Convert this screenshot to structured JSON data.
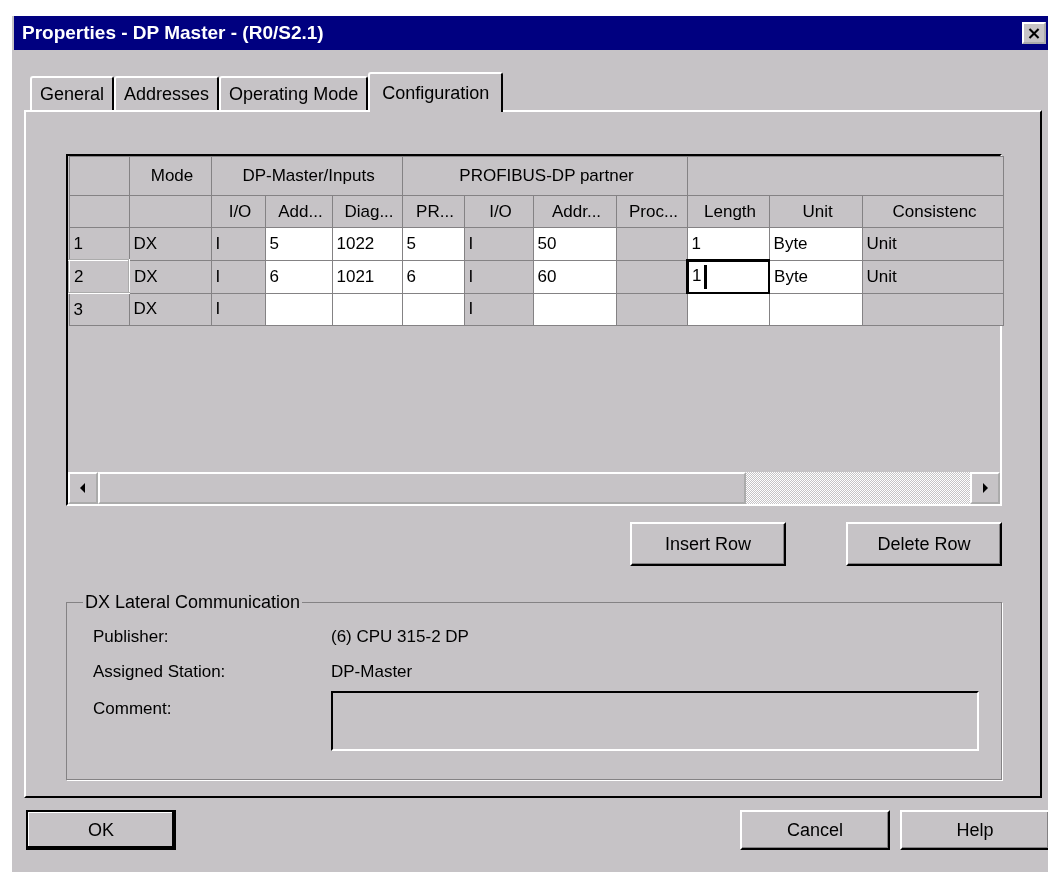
{
  "window": {
    "title": "Properties - DP Master - (R0/S2.1)",
    "close": "×"
  },
  "tabs": [
    {
      "label": "General",
      "selected": false
    },
    {
      "label": "Addresses",
      "selected": false
    },
    {
      "label": "Operating Mode",
      "selected": false
    },
    {
      "label": "Configuration",
      "selected": true
    }
  ],
  "table": {
    "groups": [
      {
        "label": "Mode",
        "columns": [
          {
            "editable": false
          }
        ]
      },
      {
        "label": "DP-Master/Inputs",
        "columns": [
          {
            "label": "I/O",
            "editable": false
          },
          {
            "label": "Add...",
            "editable": true
          },
          {
            "label": "Diag...",
            "editable": true
          }
        ]
      },
      {
        "label": "PROFIBUS-DP partner",
        "columns": [
          {
            "label": "PR...",
            "editable": true
          },
          {
            "label": "I/O",
            "editable": false
          },
          {
            "label": "Addr...",
            "editable": true
          },
          {
            "label": "Proc...",
            "editable": false
          }
        ]
      },
      {
        "columns": [
          {
            "label": "Length",
            "editable": true
          },
          {
            "label": "Unit",
            "editable": true
          },
          {
            "label": "Consistenc",
            "editable": false
          }
        ]
      }
    ],
    "rows": [
      {
        "number": "1",
        "selected": false,
        "cells": [
          {
            "value": "DX",
            "focused": false
          },
          {
            "value": "I",
            "focused": false
          },
          {
            "value": "5",
            "focused": false
          },
          {
            "value": "1022",
            "focused": false
          },
          {
            "value": "5",
            "focused": false
          },
          {
            "value": "I",
            "focused": false
          },
          {
            "value": "50",
            "focused": false
          },
          {
            "focused": false
          },
          {
            "value": "1",
            "focused": false
          },
          {
            "value": "Byte",
            "focused": false
          },
          {
            "value": "Unit",
            "focused": false
          }
        ]
      },
      {
        "number": "2",
        "selected": true,
        "cells": [
          {
            "value": "DX",
            "focused": false
          },
          {
            "value": "I",
            "focused": false
          },
          {
            "value": "6",
            "focused": false
          },
          {
            "value": "1021",
            "focused": false
          },
          {
            "value": "6",
            "focused": false
          },
          {
            "value": "I",
            "focused": false
          },
          {
            "value": "60",
            "focused": false
          },
          {
            "focused": false
          },
          {
            "value": "1",
            "focused": true
          },
          {
            "value": "Byte",
            "focused": false
          },
          {
            "value": "Unit",
            "focused": false
          }
        ]
      },
      {
        "number": "3",
        "selected": false,
        "cells": [
          {
            "value": "DX",
            "focused": false
          },
          {
            "value": "I",
            "focused": false
          },
          {
            "focused": false
          },
          {
            "focused": false
          },
          {
            "focused": false
          },
          {
            "value": "I",
            "focused": false
          },
          {
            "focused": false
          },
          {
            "focused": false
          },
          {
            "focused": false
          },
          {
            "focused": false
          },
          {
            "focused": false
          }
        ]
      }
    ]
  },
  "table_buttons": [
    "Insert Row",
    "Delete Row"
  ],
  "lateral": {
    "title": "DX Lateral Communication",
    "fields": [
      {
        "label": "Publisher:",
        "value": "(6) CPU 315-2 DP"
      },
      {
        "label": "Assigned Station:",
        "value": "DP-Master"
      }
    ],
    "comment_label": "Comment:"
  },
  "buttons": [
    {
      "label": "OK",
      "default": true
    },
    {
      "label": "Cancel",
      "default": false
    },
    {
      "label": "Help",
      "default": false
    }
  ]
}
